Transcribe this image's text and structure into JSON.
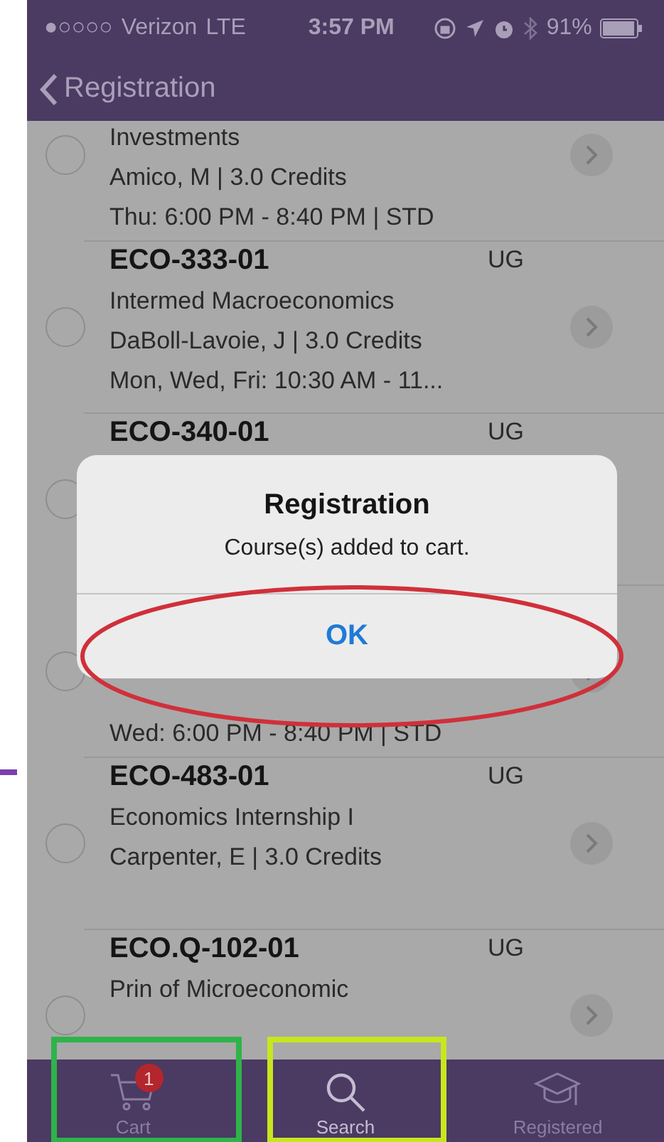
{
  "status_bar": {
    "signal": "●○○○○",
    "carrier": "Verizon",
    "network": "LTE",
    "time": "3:57 PM",
    "battery": "91%"
  },
  "nav": {
    "back_label": "Registration"
  },
  "courses": [
    {
      "selected": false,
      "lines": [
        "Investments",
        "Amico, M  | 3.0 Credits",
        "Thu: 6:00 PM - 8:40 PM  | STD"
      ]
    },
    {
      "code": "ECO-333-01",
      "level": "UG",
      "selected": false,
      "lines": [
        "Intermed Macroeconomics",
        "DaBoll-Lavoie, J  | 3.0 Credits",
        "Mon, Wed, Fri: 10:30 AM - 11..."
      ]
    },
    {
      "code": "ECO-340-01",
      "level": "UG",
      "selected": false
    },
    {
      "selected": false,
      "lines": [
        "Wed: 6:00 PM - 8:40 PM  | STD"
      ]
    },
    {
      "code": "ECO-483-01",
      "level": "UG",
      "selected": false,
      "lines": [
        "Economics Internship I",
        "Carpenter, E  | 3.0 Credits"
      ]
    },
    {
      "code": "ECO.Q-102-01",
      "level": "UG",
      "selected": false,
      "lines": [
        "Prin of Microeconomic"
      ]
    }
  ],
  "dialog": {
    "title": "Registration",
    "message": "Course(s) added to cart.",
    "button": "OK"
  },
  "tab_bar": [
    {
      "kind": "cart",
      "label": "Cart",
      "badge": "1",
      "selected": false
    },
    {
      "kind": "search",
      "label": "Search",
      "selected": true
    },
    {
      "kind": "registered",
      "label": "Registered",
      "selected": false
    }
  ],
  "annotations": [
    {
      "kind": "ellipse",
      "color": "#d0303a"
    },
    {
      "kind": "frame",
      "color": "#2fb34a"
    },
    {
      "kind": "frame",
      "color": "#c8e61e"
    },
    {
      "kind": "dash",
      "color": "#7a3fb0"
    }
  ]
}
